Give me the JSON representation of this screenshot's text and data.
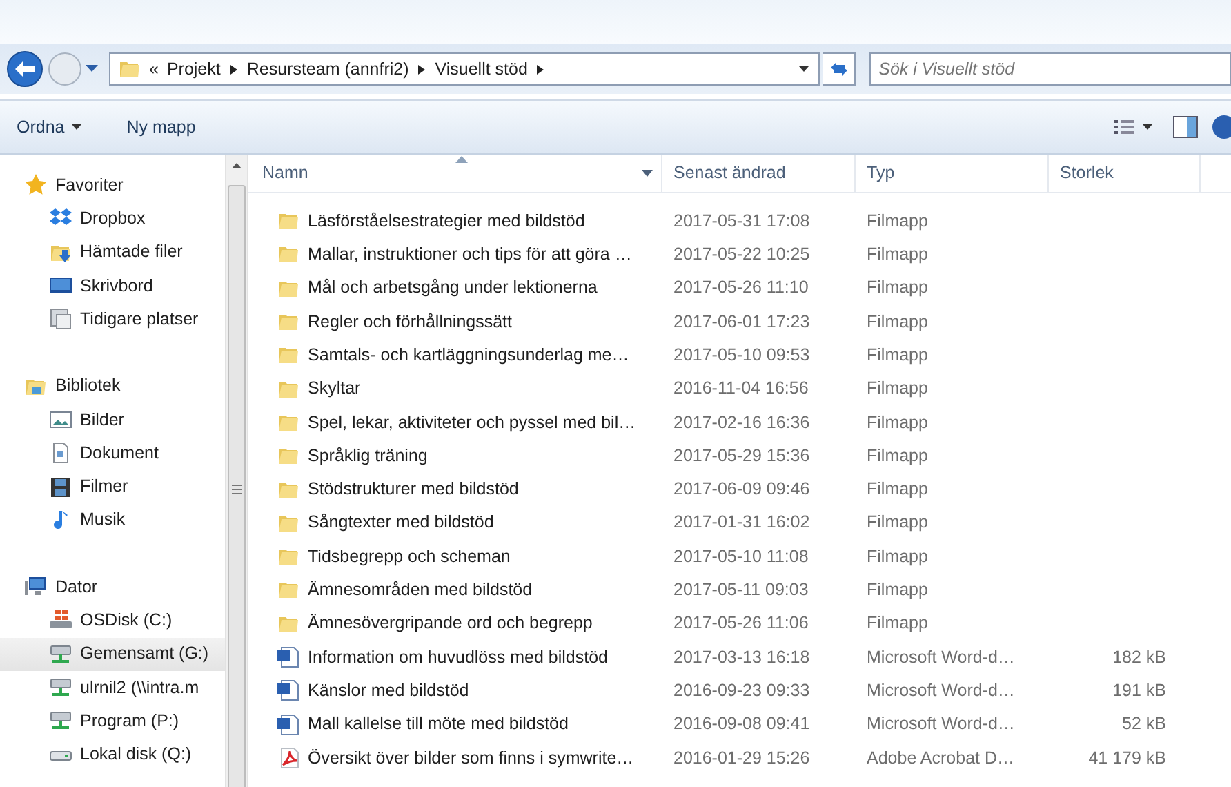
{
  "address_bar": {
    "overflow": "«",
    "segments": [
      "Projekt",
      "Resursteam (annfri2)",
      "Visuellt stöd"
    ]
  },
  "search": {
    "placeholder": "Sök i Visuellt stöd"
  },
  "toolbar": {
    "buttons": [
      {
        "label": "Ordna",
        "dropdown": true
      },
      {
        "label": "Ny mapp",
        "dropdown": false
      }
    ]
  },
  "sidebar": {
    "groups": [
      {
        "label": "Favoriter",
        "kind": "star",
        "items": [
          {
            "label": "Dropbox",
            "kind": "dropbox",
            "selected": false
          },
          {
            "label": "Hämtade filer",
            "kind": "download",
            "selected": false
          },
          {
            "label": "Skrivbord",
            "kind": "desktop",
            "selected": false
          },
          {
            "label": "Tidigare platser",
            "kind": "places",
            "selected": false
          }
        ]
      },
      {
        "label": "Bibliotek",
        "kind": "library",
        "items": [
          {
            "label": "Bilder",
            "kind": "pictures",
            "selected": false
          },
          {
            "label": "Dokument",
            "kind": "document",
            "selected": false
          },
          {
            "label": "Filmer",
            "kind": "film",
            "selected": false
          },
          {
            "label": "Musik",
            "kind": "music",
            "selected": false
          }
        ]
      },
      {
        "label": "Dator",
        "kind": "computer",
        "items": [
          {
            "label": "OSDisk (C:)",
            "kind": "system-disk",
            "selected": false
          },
          {
            "label": "Gemensamt (G:)",
            "kind": "network",
            "selected": true
          },
          {
            "label": "ulrnil2 (\\\\intra.m",
            "kind": "network",
            "selected": false
          },
          {
            "label": "Program (P:)",
            "kind": "network",
            "selected": false
          },
          {
            "label": "Lokal disk (Q:)",
            "kind": "disk",
            "selected": false
          }
        ]
      }
    ]
  },
  "table": {
    "columns": [
      "Namn",
      "Senast ändrad",
      "Typ",
      "Storlek"
    ],
    "rows": [
      {
        "kind": "folder",
        "name": "Läsförståelsestrategier med bildstöd",
        "modified": "2017-05-31 17:08",
        "type": "Filmapp"
      },
      {
        "kind": "folder",
        "name": "Mallar, instruktioner och tips för att göra …",
        "modified": "2017-05-22 10:25",
        "type": "Filmapp"
      },
      {
        "kind": "folder",
        "name": "Mål och arbetsgång under lektionerna",
        "modified": "2017-05-26 11:10",
        "type": "Filmapp"
      },
      {
        "kind": "folder",
        "name": "Regler och förhållningssätt",
        "modified": "2017-06-01 17:23",
        "type": "Filmapp"
      },
      {
        "kind": "folder",
        "name": "Samtals- och kartläggningsunderlag me…",
        "modified": "2017-05-10 09:53",
        "type": "Filmapp"
      },
      {
        "kind": "folder",
        "name": "Skyltar",
        "modified": "2016-11-04 16:56",
        "type": "Filmapp"
      },
      {
        "kind": "folder",
        "name": "Spel, lekar, aktiviteter och pyssel med bil…",
        "modified": "2017-02-16 16:36",
        "type": "Filmapp"
      },
      {
        "kind": "folder",
        "name": "Språklig träning",
        "modified": "2017-05-29 15:36",
        "type": "Filmapp"
      },
      {
        "kind": "folder",
        "name": "Stödstrukturer med bildstöd",
        "modified": "2017-06-09 09:46",
        "type": "Filmapp"
      },
      {
        "kind": "folder",
        "name": "Sångtexter med bildstöd",
        "modified": "2017-01-31 16:02",
        "type": "Filmapp"
      },
      {
        "kind": "folder",
        "name": "Tidsbegrepp och scheman",
        "modified": "2017-05-10 11:08",
        "type": "Filmapp"
      },
      {
        "kind": "folder",
        "name": "Ämnesområden med bildstöd",
        "modified": "2017-05-11 09:03",
        "type": "Filmapp"
      },
      {
        "kind": "folder",
        "name": "Ämnesövergripande ord och begrepp",
        "modified": "2017-05-26 11:06",
        "type": "Filmapp"
      },
      {
        "kind": "word",
        "name": "Information om huvudlöss med bildstöd",
        "modified": "2017-03-13 16:18",
        "type": "Microsoft Word-d…",
        "size": "182 kB"
      },
      {
        "kind": "word",
        "name": "Känslor med bildstöd",
        "modified": "2016-09-23 09:33",
        "type": "Microsoft Word-d…",
        "size": "191 kB"
      },
      {
        "kind": "word",
        "name": "Mall kallelse till möte med bildstöd",
        "modified": "2016-09-08 09:41",
        "type": "Microsoft Word-d…",
        "size": "52 kB"
      },
      {
        "kind": "pdf",
        "name": "Översikt över bilder som finns i symwrite…",
        "modified": "2016-01-29 15:26",
        "type": "Adobe Acrobat D…",
        "size": "41 179 kB"
      }
    ]
  }
}
